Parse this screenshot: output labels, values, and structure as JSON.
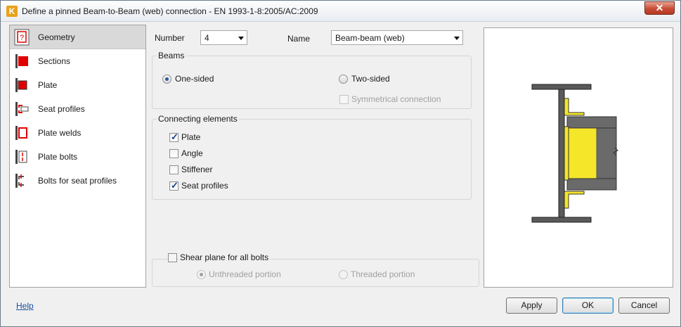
{
  "window": {
    "title": "Define a pinned Beam-to-Beam (web) connection - EN 1993-1-8:2005/AC:2009",
    "app_icon_letter": "K",
    "close_glyph": "✕"
  },
  "sidebar": {
    "items": [
      {
        "label": "Geometry",
        "icon": "geometry-icon"
      },
      {
        "label": "Sections",
        "icon": "sections-icon"
      },
      {
        "label": "Plate",
        "icon": "plate-icon"
      },
      {
        "label": "Seat profiles",
        "icon": "seat-profiles-icon"
      },
      {
        "label": "Plate welds",
        "icon": "plate-welds-icon"
      },
      {
        "label": "Plate bolts",
        "icon": "plate-bolts-icon"
      },
      {
        "label": "Bolts for seat profiles",
        "icon": "bolts-seat-profiles-icon"
      }
    ],
    "selected": "Geometry"
  },
  "form": {
    "number_label": "Number",
    "number_value": "4",
    "name_label": "Name",
    "name_value": "Beam-beam (web)",
    "beams": {
      "title": "Beams",
      "one_sided": "One-sided",
      "two_sided": "Two-sided",
      "symmetrical": "Symmetrical connection",
      "selected": "One-sided"
    },
    "connecting": {
      "title": "Connecting elements",
      "items": [
        {
          "label": "Plate",
          "checked": true
        },
        {
          "label": "Angle",
          "checked": false
        },
        {
          "label": "Stiffener",
          "checked": false
        },
        {
          "label": "Seat profiles",
          "checked": true
        }
      ]
    },
    "shear": {
      "label": "Shear plane for all bolts",
      "checked": false,
      "unthreaded": "Unthreaded portion",
      "threaded": "Threaded portion",
      "selected": "Unthreaded portion"
    }
  },
  "footer": {
    "help": "Help",
    "apply": "Apply",
    "ok": "OK",
    "cancel": "Cancel"
  },
  "colors": {
    "accent_red": "#e00000",
    "yellow": "#f5e62a",
    "steel_grey": "#5a5a5a"
  }
}
